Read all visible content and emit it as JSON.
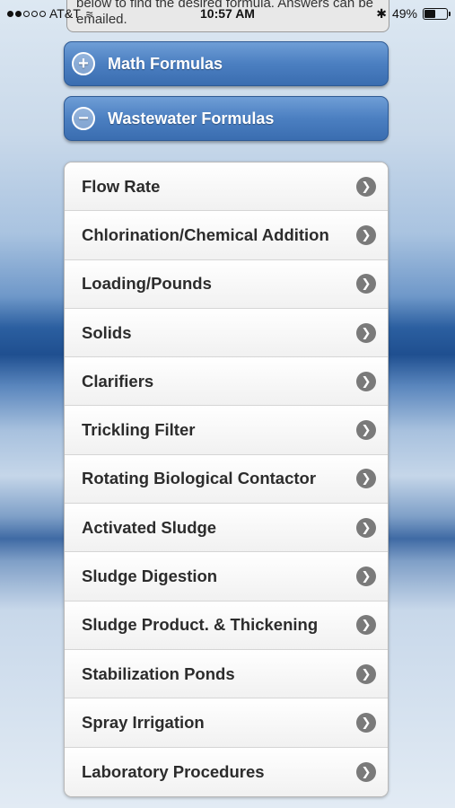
{
  "status_bar": {
    "carrier": "AT&T",
    "time": "10:57 AM",
    "battery": "49%",
    "battery_level": 0.49
  },
  "instructions": {
    "text": "below to find the desired formula. Answers can be emailed."
  },
  "collapsibles": [
    {
      "label": "Math Formulas",
      "icon": "plus-circle-icon",
      "symbol": "+"
    },
    {
      "label": "Wastewater Formulas",
      "icon": "minus-circle-icon",
      "symbol": "−"
    }
  ],
  "list": {
    "items": [
      {
        "label": "Flow Rate"
      },
      {
        "label": "Chlorination/Chemical Addition"
      },
      {
        "label": "Loading/Pounds"
      },
      {
        "label": "Solids"
      },
      {
        "label": "Clarifiers"
      },
      {
        "label": "Trickling Filter"
      },
      {
        "label": "Rotating Biological Contactor"
      },
      {
        "label": "Activated Sludge"
      },
      {
        "label": "Sludge Digestion"
      },
      {
        "label": "Sludge Product. & Thickening"
      },
      {
        "label": "Stabilization Ponds"
      },
      {
        "label": "Spray Irrigation"
      },
      {
        "label": "Laboratory Procedures"
      }
    ],
    "chevron_icon": "chevron-right-circle-icon"
  },
  "colors": {
    "header_button": "#4b7fc1",
    "chevron": "#7a7a7a",
    "row_text": "#2c2c2c"
  }
}
